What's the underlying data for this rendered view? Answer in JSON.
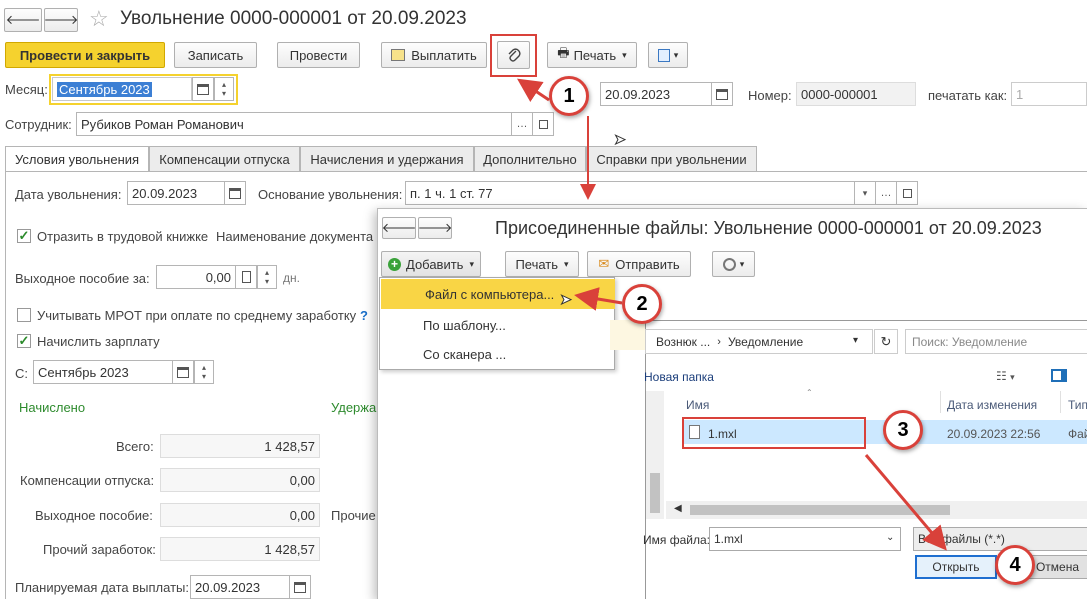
{
  "window": {
    "title": "Увольнение 0000-000001 от 20.09.2023"
  },
  "toolbar": {
    "post_close": "Провести и закрыть",
    "save": "Записать",
    "post": "Провести",
    "pay": "Выплатить",
    "print": "Печать"
  },
  "header": {
    "month_label": "Месяц:",
    "month_value": "Сентябрь 2023",
    "date_value": "20.09.2023",
    "number_label": "Номер:",
    "number_value": "0000-000001",
    "print_as_label": "печатать как:",
    "print_as_value": "1",
    "employee_label": "Сотрудник:",
    "employee_value": "Рубиков Роман Романович"
  },
  "tabs": [
    "Условия увольнения",
    "Компенсации отпуска",
    "Начисления и удержания",
    "Дополнительно",
    "Справки при увольнении"
  ],
  "form": {
    "dismissal_date_label": "Дата увольнения:",
    "dismissal_date": "20.09.2023",
    "basis_label": "Основание увольнения:",
    "basis_value": "п. 1 ч. 1 ст. 77",
    "workbook_label": "Отразить в трудовой книжке",
    "doc_name_label": "Наименование документа",
    "severance_label": "Выходное пособие за:",
    "severance_value": "0,00",
    "severance_unit": "дн.",
    "mrot_label": "Учитывать МРОТ при оплате по среднему заработку",
    "help": "?",
    "salary_label": "Начислить зарплату",
    "from_label": "С:",
    "from_value": "Сентябрь 2023",
    "accrued_label": "Начислено",
    "withheld_label": "Удержа",
    "total_label": "Всего:",
    "total_value": "1 428,57",
    "vacation_comp_label": "Компенсации отпуска:",
    "vacation_comp_value": "0,00",
    "severance_pay_label": "Выходное пособие:",
    "severance_pay_value": "0,00",
    "other_label": "Прочие",
    "other_earnings_label": "Прочий заработок:",
    "other_earnings_value": "1 428,57",
    "planned_date_label": "Планируемая дата выплаты:",
    "planned_date_value": "20.09.2023"
  },
  "attached": {
    "title": "Присоединенные файлы: Увольнение 0000-000001 от 20.09.2023",
    "add": "Добавить",
    "print": "Печать",
    "send": "Отправить",
    "menu": [
      "Файл с компьютера...",
      "По шаблону...",
      "Со сканера ..."
    ]
  },
  "file_dialog": {
    "path_parent": "Вознюк ...",
    "path_current": "Уведомление",
    "search_placeholder": "Поиск: Уведомление",
    "new_folder": "Новая папка",
    "col_name": "Имя",
    "col_date": "Дата изменения",
    "col_type": "Тип",
    "file_name": "1.mxl",
    "file_date": "20.09.2023 22:56",
    "file_type": "Фай",
    "filename_label": "Имя файла:",
    "filename_value": "1.mxl",
    "filter": "Все файлы (*.*)",
    "open": "Открыть",
    "cancel": "Отмена"
  },
  "callouts": [
    "1",
    "2",
    "3",
    "4"
  ],
  "colors": {
    "accent_yellow": "#f5d22e",
    "callout_red": "#d9413a",
    "green_text": "#2e8b2e",
    "selection_blue": "#cce8ff"
  }
}
